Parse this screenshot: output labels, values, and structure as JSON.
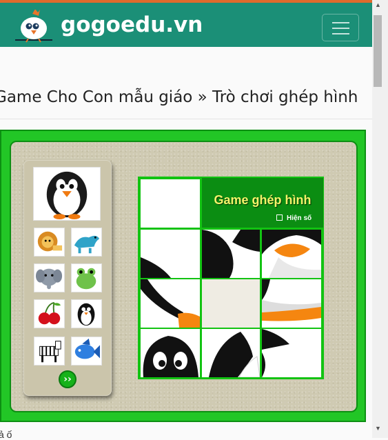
{
  "header": {
    "site_title": "gogoedu.vn",
    "logo_icon": "bird-logo-icon",
    "menu_icon": "hamburger-menu-icon",
    "bg_color": "#1b8f77"
  },
  "breadcrumb": {
    "text": "Game Cho Con mẫu giáo » Trò chơi ghép hình"
  },
  "game": {
    "title": "Game ghép hình",
    "show_numbers_label": "Hiện số",
    "show_numbers_checked": true,
    "next_label": "››",
    "empty_tile": {
      "row": 2,
      "col": 1
    },
    "frame_color": "#22c626",
    "title_color": "#f4f36a"
  },
  "thumbnails": [
    {
      "name": "lion-thumb-icon"
    },
    {
      "name": "dinosaur-thumb-icon"
    },
    {
      "name": "elephant-thumb-icon"
    },
    {
      "name": "frog-thumb-icon"
    },
    {
      "name": "cherry-thumb-icon"
    },
    {
      "name": "penguin-thumb-icon"
    },
    {
      "name": "zebra-thumb-icon"
    },
    {
      "name": "fish-thumb-icon"
    }
  ],
  "footer": {
    "partial_text": "ả ố"
  }
}
